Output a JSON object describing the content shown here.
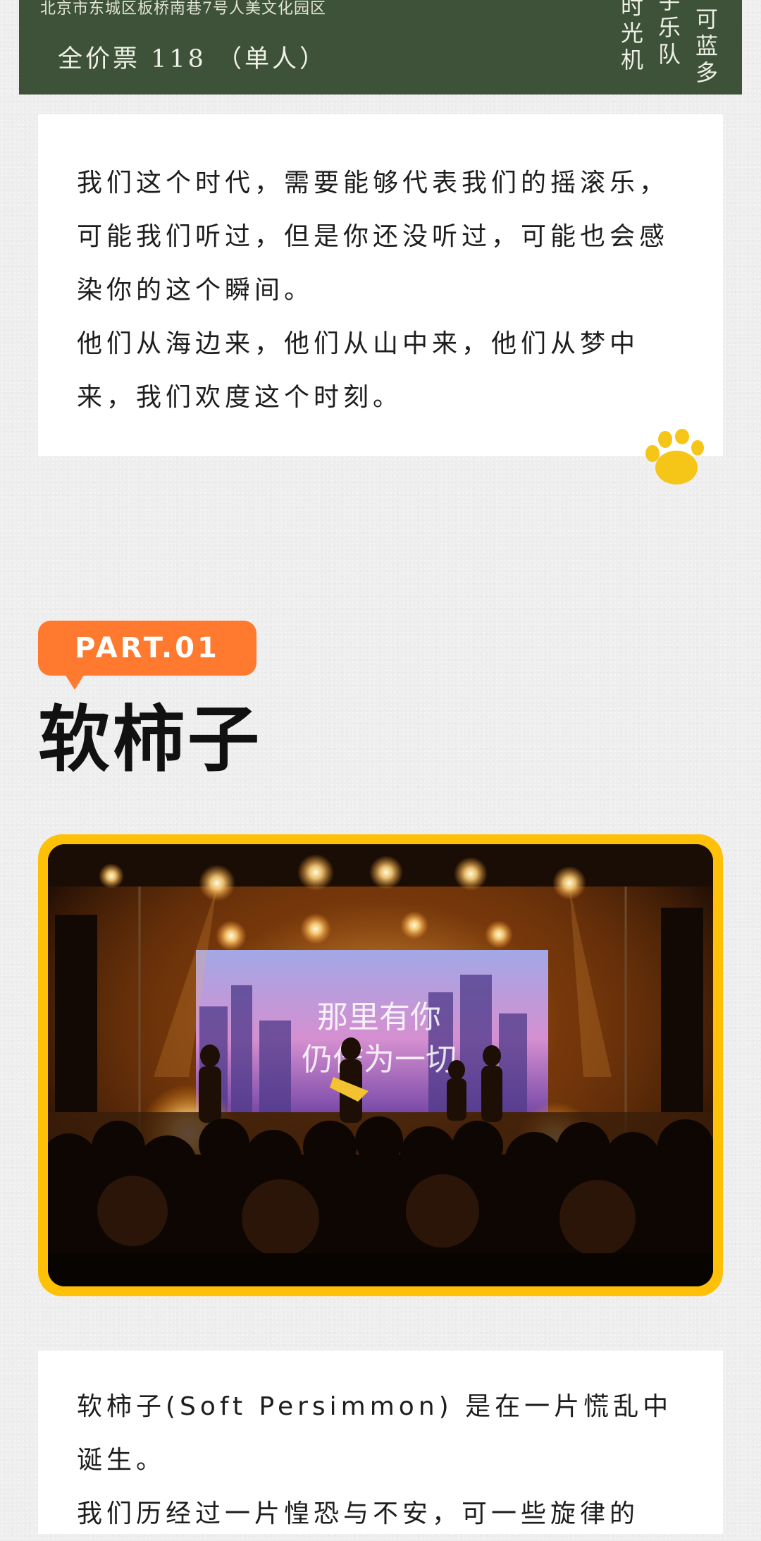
{
  "banner": {
    "address": "北京市东城区板桥南巷7号人美文化园区",
    "ticket": "全价票 118 （单人）",
    "columns": [
      "时光机",
      "宇乐队",
      "可蓝多"
    ]
  },
  "intro_card": {
    "paragraphs": [
      "我们这个时代，需要能够代表我们的摇滚乐，可能我们听过，但是你还没听过，可能也会感染你的这个瞬间。",
      "他们从海边来，他们从山中来，他们从梦中来，我们欢度这个时刻。"
    ]
  },
  "section": {
    "part_label": "PART.01",
    "band_name": "软柿子"
  },
  "photo": {
    "screen_text_line1": "那里有你",
    "screen_text_line2": "仍作为一切"
  },
  "band_card": {
    "paragraphs": [
      "软柿子(Soft Persimmon) 是在一片慌乱中诞生。",
      "我们历经过一片惶恐与不安，可一些旋律的"
    ]
  },
  "colors": {
    "banner_green": "#3d5238",
    "accent_orange": "#ff7a2f",
    "frame_yellow": "#ffc107",
    "paw_yellow": "#f5c518"
  },
  "icons": {
    "paw": "paw-icon"
  }
}
